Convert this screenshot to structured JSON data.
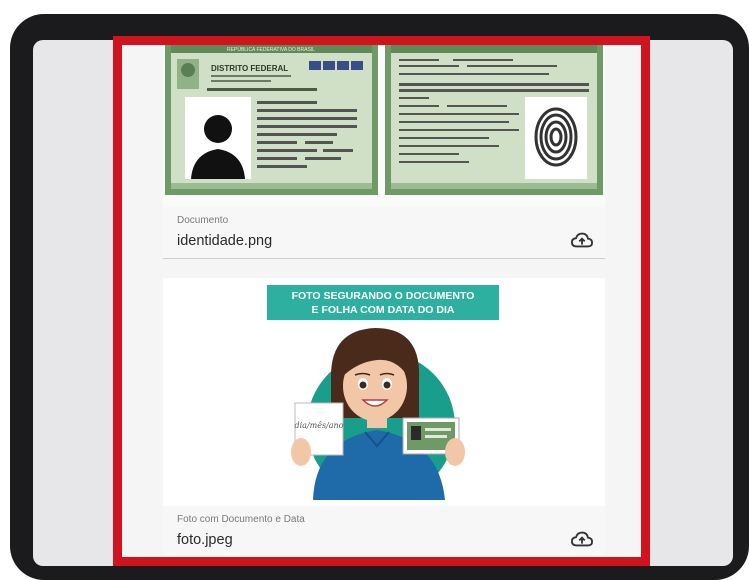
{
  "files": [
    {
      "caption": "Documento",
      "filename": "identidade.png",
      "card_text": {
        "header": "REPÚBLICA FEDERATIVA DO BRASIL",
        "state": "DISTRITO FEDERAL"
      }
    },
    {
      "caption": "Foto com Documento e Data",
      "filename": "foto.jpeg",
      "banner": [
        "FOTO SEGURANDO O DOCUMENTO",
        "E FOLHA COM DATA DO DIA"
      ],
      "paper_text": "dia/mês/ano"
    }
  ],
  "colors": {
    "frame": "#d0131c",
    "id_green": "#6f9a68",
    "banner": "#2eb0a0",
    "circle": "#1a9e8c",
    "shirt": "#1f6aa8"
  },
  "icons": [
    "cloud-upload-icon",
    "fingerprint-icon",
    "person-silhouette-icon"
  ]
}
